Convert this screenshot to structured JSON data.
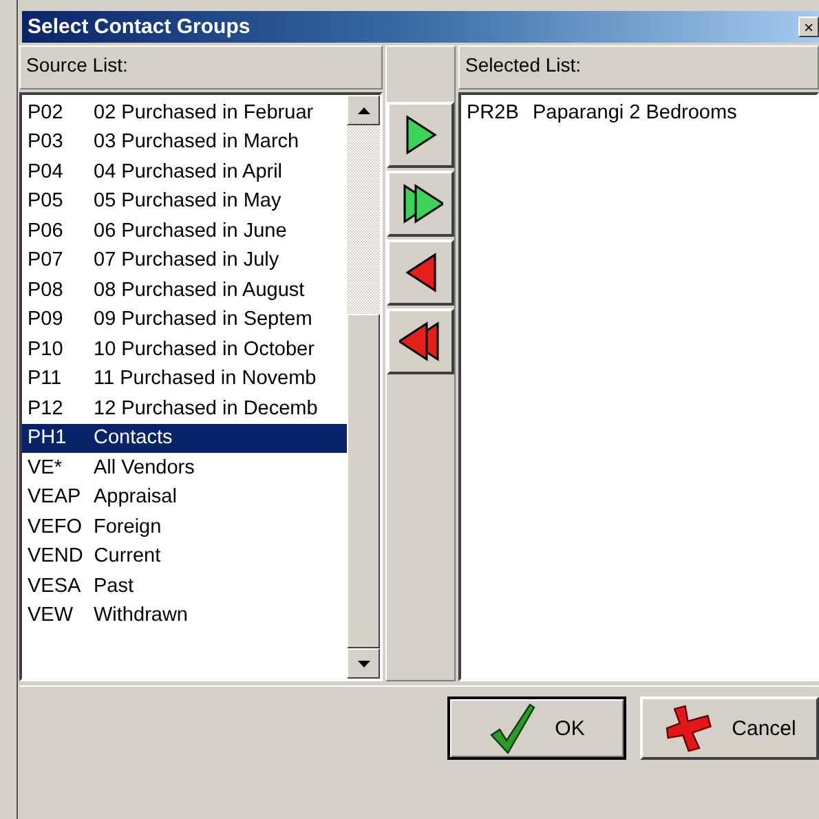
{
  "window": {
    "title": "Select Contact Groups",
    "close": "×"
  },
  "source": {
    "label": "Source List:",
    "items": [
      {
        "code": "P02",
        "name": "02 Purchased in Februar",
        "selected": false
      },
      {
        "code": "P03",
        "name": "03 Purchased in March",
        "selected": false
      },
      {
        "code": "P04",
        "name": "04 Purchased in April",
        "selected": false
      },
      {
        "code": "P05",
        "name": "05 Purchased in May",
        "selected": false
      },
      {
        "code": "P06",
        "name": "06 Purchased in June",
        "selected": false
      },
      {
        "code": "P07",
        "name": "07 Purchased in July",
        "selected": false
      },
      {
        "code": "P08",
        "name": "08 Purchased in August",
        "selected": false
      },
      {
        "code": "P09",
        "name": "09 Purchased in Septem",
        "selected": false
      },
      {
        "code": "P10",
        "name": "10 Purchased in October",
        "selected": false
      },
      {
        "code": "P11",
        "name": "11 Purchased in Novemb",
        "selected": false
      },
      {
        "code": "P12",
        "name": "12 Purchased in Decemb",
        "selected": false
      },
      {
        "code": "PH1",
        "name": "Contacts",
        "selected": true
      },
      {
        "code": "VE*",
        "name": "All Vendors",
        "selected": false
      },
      {
        "code": "VEAP",
        "name": "Appraisal",
        "selected": false
      },
      {
        "code": "VEFO",
        "name": "Foreign",
        "selected": false
      },
      {
        "code": "VEND",
        "name": "Current",
        "selected": false
      },
      {
        "code": "VESA",
        "name": "Past",
        "selected": false
      },
      {
        "code": "VEW",
        "name": "Withdrawn",
        "selected": false
      }
    ]
  },
  "transfer_buttons": [
    {
      "kind": "add"
    },
    {
      "kind": "add_all"
    },
    {
      "kind": "remove"
    },
    {
      "kind": "remove_all"
    }
  ],
  "selected_list": {
    "label": "Selected List:",
    "items": [
      {
        "code": "PR2B",
        "name": "Paparangi 2 Bedrooms",
        "selected": false
      }
    ]
  },
  "buttons": [
    {
      "kind": "ok",
      "label": "OK",
      "default": true
    },
    {
      "kind": "cancel",
      "label": "Cancel",
      "default": false
    }
  ]
}
